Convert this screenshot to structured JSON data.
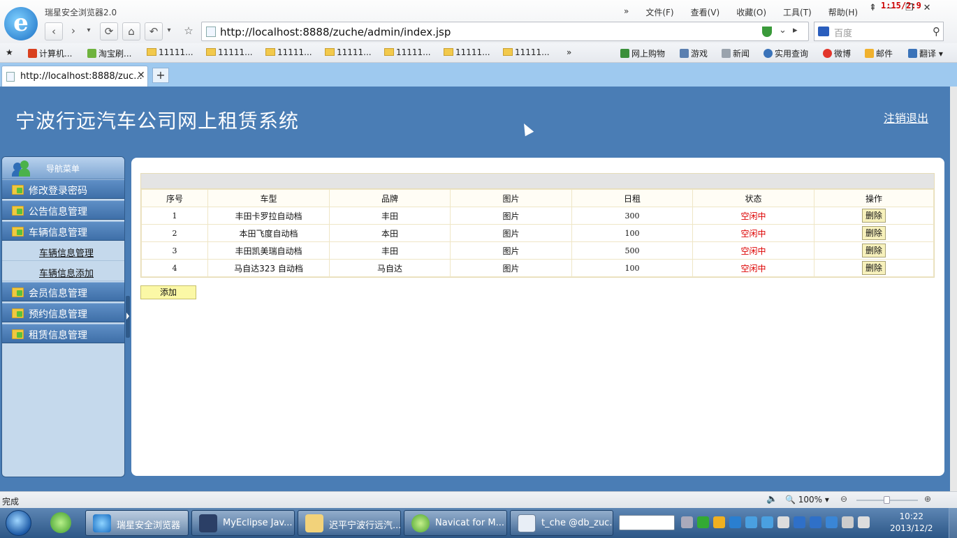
{
  "browser": {
    "name": "瑞星安全浏览器2.0",
    "logo_glyph": "e",
    "menu": [
      "文件(F)",
      "查看(V)",
      "收藏(O)",
      "工具(T)",
      "帮助(H)"
    ],
    "overlay_clock": "1:15/2:9",
    "url": "http://localhost:8888/zuche/admin/index.jsp",
    "search_placeholder": "百度",
    "bookmarks": [
      {
        "label": "计算机...",
        "icon": "red-app-icon"
      },
      {
        "label": "淘宝刷...",
        "icon": "taobao-icon"
      },
      {
        "label": "11111...",
        "icon": "folder-icon"
      },
      {
        "label": "11111...",
        "icon": "folder-icon"
      },
      {
        "label": "11111...",
        "icon": "folder-icon"
      },
      {
        "label": "11111...",
        "icon": "folder-icon"
      },
      {
        "label": "11111...",
        "icon": "folder-icon"
      },
      {
        "label": "11111...",
        "icon": "folder-icon"
      },
      {
        "label": "11111...",
        "icon": "folder-icon"
      }
    ],
    "bookmarks_more": "»",
    "quicklinks": [
      {
        "label": "网上购物",
        "icon": "cart-icon"
      },
      {
        "label": "游戏",
        "icon": "game-icon"
      },
      {
        "label": "新闻",
        "icon": "news-icon"
      },
      {
        "label": "实用查询",
        "icon": "magnifier-icon"
      },
      {
        "label": "微博",
        "icon": "weibo-icon"
      },
      {
        "label": "邮件",
        "icon": "mail-icon"
      },
      {
        "label": "翻译",
        "icon": "translate-icon"
      }
    ],
    "tab_title": "http://localhost:8888/zuc...",
    "tab_close": "✕",
    "tab_new": "+"
  },
  "site": {
    "title": "宁波行远汽车公司网上租赁系统",
    "logout": "注销退出"
  },
  "sidebar": {
    "header": "导航菜单",
    "items": [
      {
        "label": "修改登录密码"
      },
      {
        "label": "公告信息管理"
      },
      {
        "label": "车辆信息管理",
        "sub": [
          "车辆信息管理",
          "车辆信息添加"
        ]
      },
      {
        "label": "会员信息管理"
      },
      {
        "label": "预约信息管理"
      },
      {
        "label": "租赁信息管理"
      }
    ]
  },
  "table": {
    "columns": [
      "序号",
      "车型",
      "品牌",
      "图片",
      "日租",
      "状态",
      "操作"
    ],
    "rows": [
      {
        "no": "1",
        "model": "丰田卡罗拉自动档",
        "brand": "丰田",
        "image": "图片",
        "daily": "300",
        "status": "空闲中",
        "action": "删除"
      },
      {
        "no": "2",
        "model": "本田飞度自动档",
        "brand": "本田",
        "image": "图片",
        "daily": "100",
        "status": "空闲中",
        "action": "删除"
      },
      {
        "no": "3",
        "model": "丰田凯美瑞自动档",
        "brand": "丰田",
        "image": "图片",
        "daily": "500",
        "status": "空闲中",
        "action": "删除"
      },
      {
        "no": "4",
        "model": "马自达323 自动档",
        "brand": "马自达",
        "image": "图片",
        "daily": "100",
        "status": "空闲中",
        "action": "删除"
      }
    ],
    "add_label": "添加"
  },
  "statusbar": {
    "text": "完成",
    "zoom": "100%"
  },
  "taskbar": {
    "tasks": [
      {
        "label": "瑞星安全浏览器",
        "icon": "ie-icon",
        "active": true
      },
      {
        "label": "MyEclipse Jav...",
        "icon": "myeclipse-icon"
      },
      {
        "label": "迟平宁波行远汽...",
        "icon": "folder-icon"
      },
      {
        "label": "Navicat for M...",
        "icon": "navicat-icon"
      },
      {
        "label": "t_che @db_zuc...",
        "icon": "table-icon"
      }
    ],
    "clock_time": "10:22",
    "clock_date": "2013/12/2"
  },
  "colors": {
    "page_bg": "#4a7db5",
    "status_free": "#dd0000",
    "button_bg": "#f7f1bc"
  }
}
